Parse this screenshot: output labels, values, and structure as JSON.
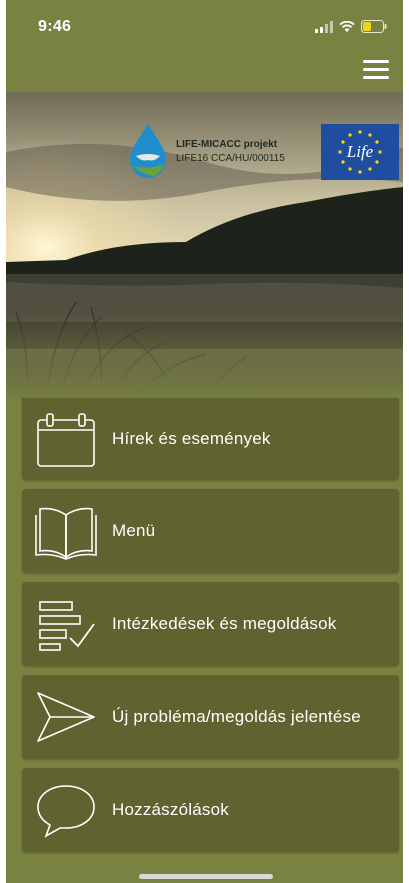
{
  "status_bar": {
    "time": "9:46"
  },
  "header": {
    "project_title": "LIFE-MICACC projekt",
    "project_code": "LIFE16 CCA/HU/000115",
    "eu_logo_text": "Life"
  },
  "menu": {
    "items": [
      {
        "label": "Hírek és események",
        "icon": "calendar-icon"
      },
      {
        "label": "Menü",
        "icon": "book-icon"
      },
      {
        "label": "Intézkedések és megoldások",
        "icon": "checklist-icon"
      },
      {
        "label": "Új probléma/megoldás jelentése",
        "icon": "send-icon"
      },
      {
        "label": "Hozzászólások",
        "icon": "speech-bubble-icon"
      }
    ]
  },
  "colors": {
    "background": "#7a8242",
    "item": "#5f632f",
    "text": "#ffffff",
    "eu_blue": "#1f4ea0",
    "eu_star": "#ffdd00"
  }
}
